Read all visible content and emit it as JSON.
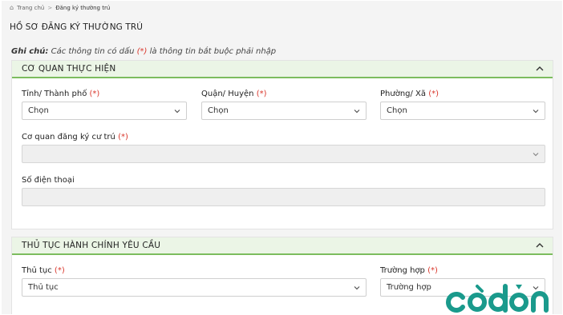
{
  "breadcrumb": {
    "home": "Trang chủ",
    "current": "Đăng ký thường trú"
  },
  "page_title": "HỒ SƠ ĐĂNG KÝ THƯỜNG TRÚ",
  "note": {
    "label": "Ghi chú:",
    "text_before": " Các thông tin có dấu ",
    "marker": "(*)",
    "text_after": " là thông tin bắt buộc phải nhập"
  },
  "section1": {
    "title": "CƠ QUAN THỰC HIỆN",
    "province": {
      "label": "Tỉnh/ Thành phố",
      "required": "(*)",
      "value": "Chọn"
    },
    "district": {
      "label": "Quận/ Huyện",
      "required": "(*)",
      "value": "Chọn"
    },
    "ward": {
      "label": "Phường/ Xã",
      "required": "(*)",
      "value": "Chọn"
    },
    "agency": {
      "label": "Cơ quan đăng ký cư trú",
      "required": "(*)",
      "value": ""
    },
    "phone": {
      "label": "Số điện thoại",
      "value": ""
    }
  },
  "section2": {
    "title": "THỦ TỤC HÀNH CHÍNH YÊU CẦU",
    "procedure": {
      "label": "Thủ tục",
      "required": "(*)",
      "value": "Thủ tục"
    },
    "case": {
      "label": "Trường hợp",
      "required": "(*)",
      "value": "Trường hợp"
    }
  },
  "watermark": {
    "text": "cóđơn"
  },
  "colors": {
    "accent_green": "#7cbc5e",
    "header_bg": "#ebf5e6",
    "required_red": "#d9362b",
    "logo_teal": "#1a9a8c"
  },
  "icons": {
    "home": "home-icon",
    "collapse": "chevron-up-icon",
    "dropdown": "chevron-down-icon"
  }
}
